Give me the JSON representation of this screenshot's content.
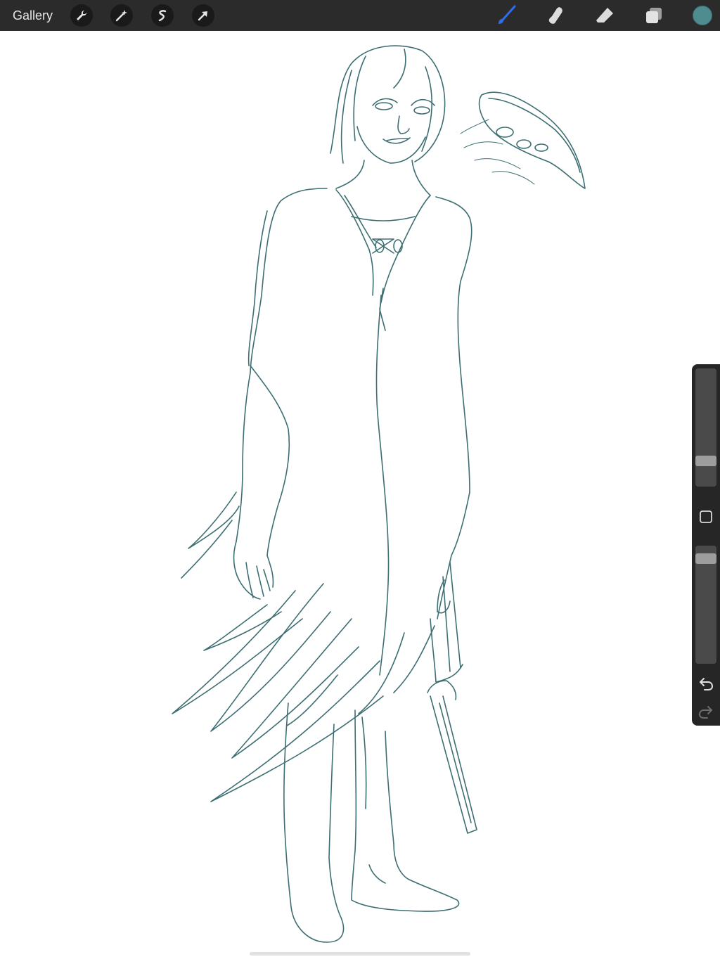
{
  "toolbar": {
    "gallery_label": "Gallery",
    "left_tools": [
      "wrench-icon",
      "magic-wand-icon",
      "selection-icon",
      "transform-arrow-icon"
    ],
    "right_tools": [
      "brush-icon",
      "smudge-icon",
      "eraser-icon",
      "layers-icon"
    ],
    "active_tool": "brush",
    "active_tool_color": "#2f6df0",
    "current_color": "#4f8c8f"
  },
  "canvas": {
    "stroke_color": "#3d6e72",
    "background": "#ffffff"
  },
  "sidebar": {
    "brush_size_level": 0.19,
    "opacity_level": 0.93,
    "controls": [
      "modify-button",
      "undo-icon",
      "redo-icon"
    ]
  }
}
